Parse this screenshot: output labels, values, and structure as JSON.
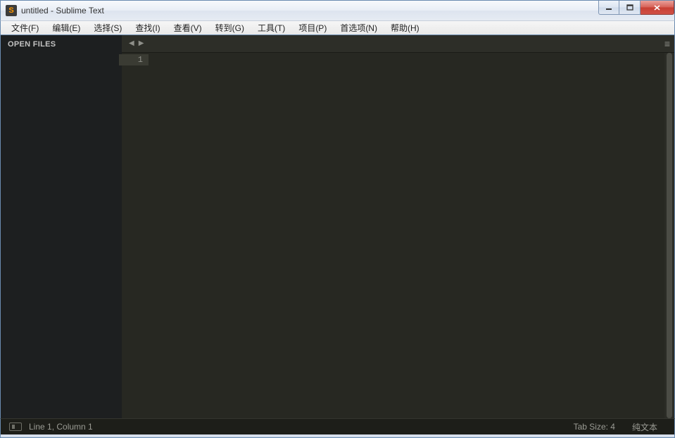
{
  "window": {
    "title": "untitled - Sublime Text",
    "app_icon_letter": "S"
  },
  "menu": {
    "items": [
      "文件(F)",
      "编辑(E)",
      "选择(S)",
      "查找(I)",
      "查看(V)",
      "转到(G)",
      "工具(T)",
      "项目(P)",
      "首选项(N)",
      "帮助(H)"
    ]
  },
  "sidebar": {
    "open_files_label": "OPEN FILES"
  },
  "editor": {
    "line_numbers": [
      "1"
    ],
    "lines": [
      ""
    ]
  },
  "status": {
    "position": "Line 1, Column 1",
    "tab_size": "Tab Size: 4",
    "syntax": "纯文本"
  }
}
